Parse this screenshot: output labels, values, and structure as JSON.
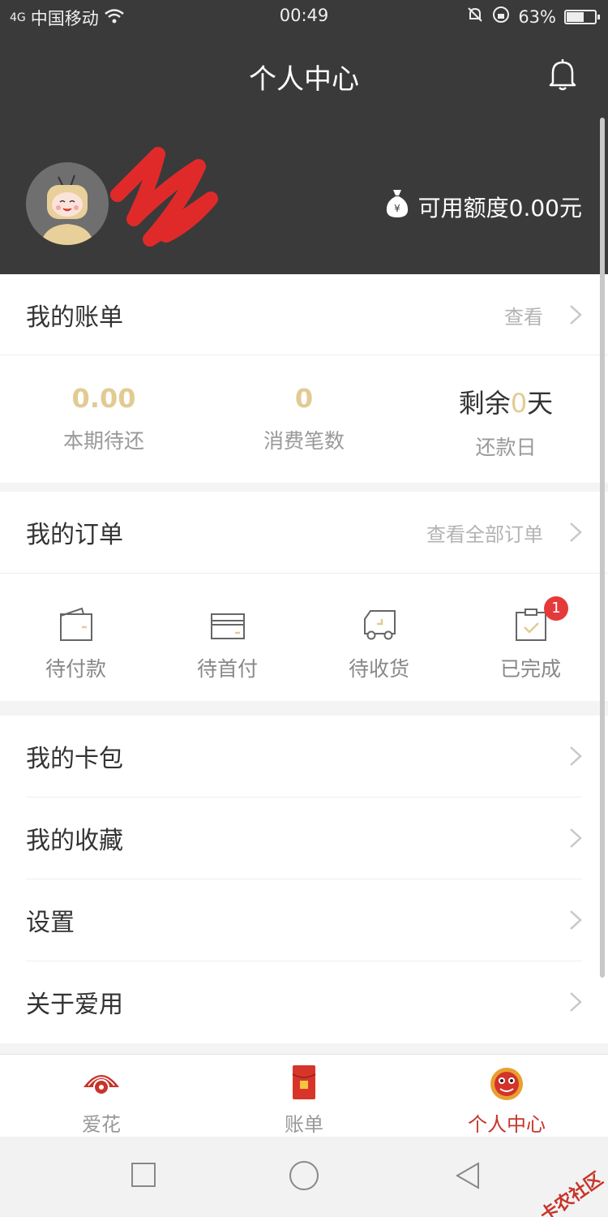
{
  "status": {
    "network": "4G",
    "carrier": "中国移动",
    "time": "00:49",
    "battery": "63%",
    "battery_level": 0.63
  },
  "header": {
    "title": "个人中心",
    "credit_text": "可用额度0.00元"
  },
  "bill": {
    "title": "我的账单",
    "view_label": "查看",
    "stats": [
      {
        "value": "0.00",
        "caption": "本期待还"
      },
      {
        "value": "0",
        "caption": "消费笔数"
      }
    ],
    "due": {
      "prefix": "剩余",
      "days": "0",
      "suffix": "天",
      "caption": "还款日"
    }
  },
  "orders": {
    "title": "我的订单",
    "view_all_label": "查看全部订单",
    "items": [
      {
        "label": "待付款"
      },
      {
        "label": "待首付"
      },
      {
        "label": "待收货"
      },
      {
        "label": "已完成",
        "badge": "1"
      }
    ]
  },
  "menu": {
    "items": [
      {
        "label": "我的卡包"
      },
      {
        "label": "我的收藏"
      },
      {
        "label": "设置"
      },
      {
        "label": "关于爱用"
      }
    ]
  },
  "tabbar": {
    "items": [
      {
        "label": "爱花",
        "active": false
      },
      {
        "label": "账单",
        "active": false
      },
      {
        "label": "个人中心",
        "active": true
      }
    ],
    "active_color": "#c7342a"
  },
  "watermark": "卡农社区",
  "colors": {
    "header_bg": "#3a3a3a",
    "accent_gold": "#e2cb93",
    "badge_red": "#e53a3a"
  }
}
